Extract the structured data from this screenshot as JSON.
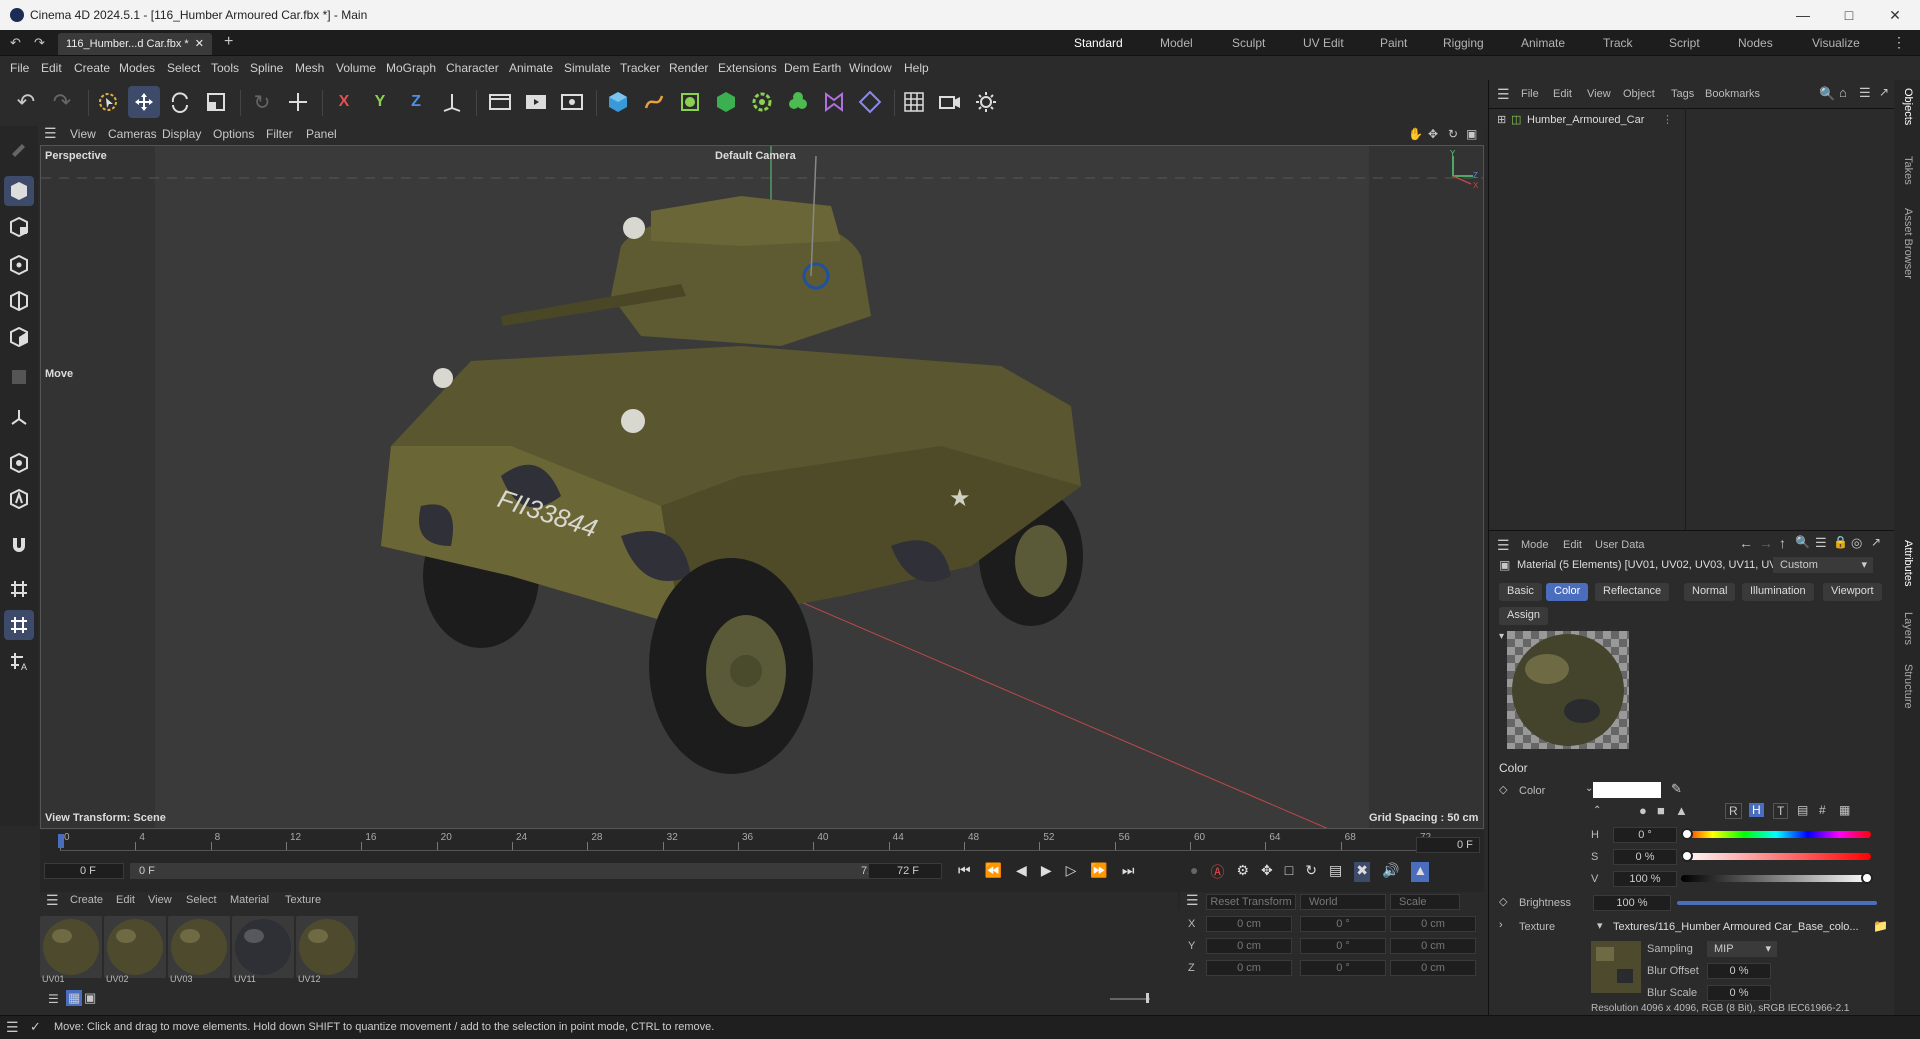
{
  "window": {
    "title": "Cinema 4D 2024.5.1 - [116_Humber Armoured Car.fbx *] - Main"
  },
  "doc_tab": {
    "label": "116_Humber...d Car.fbx *"
  },
  "layouts": [
    "Standard",
    "Model",
    "Sculpt",
    "UV Edit",
    "Paint",
    "Rigging",
    "Animate",
    "Track",
    "Script",
    "Nodes",
    "Visualize"
  ],
  "menu": [
    "File",
    "Edit",
    "Create",
    "Modes",
    "Select",
    "Tools",
    "Spline",
    "Mesh",
    "Volume",
    "MoGraph",
    "Character",
    "Animate",
    "Simulate",
    "Tracker",
    "Render",
    "Extensions",
    "Dem Earth",
    "Window",
    "Help"
  ],
  "axis_labels": {
    "x": "X",
    "y": "Y",
    "z": "Z"
  },
  "viewport_menu": [
    "View",
    "Cameras",
    "Display",
    "Options",
    "Filter",
    "Panel"
  ],
  "viewport": {
    "name": "Perspective",
    "camera": "Default Camera",
    "tool": "Move",
    "view_transform": "View Transform: Scene",
    "grid_spacing": "Grid Spacing : 50 cm",
    "plate": "FII33844"
  },
  "timeline": {
    "ticks": [
      "0",
      "4",
      "8",
      "12",
      "16",
      "20",
      "24",
      "28",
      "32",
      "36",
      "40",
      "44",
      "48",
      "52",
      "56",
      "60",
      "64",
      "68",
      "72"
    ],
    "current": "0 F",
    "start": "0 F",
    "range_start": "0 F",
    "range_end": "72 F",
    "end": "72 F"
  },
  "material_menu": [
    "Create",
    "Edit",
    "View",
    "Select",
    "Material",
    "Texture"
  ],
  "materials": [
    {
      "label": "UV01"
    },
    {
      "label": "UV02"
    },
    {
      "label": "UV03"
    },
    {
      "label": "UV11"
    },
    {
      "label": "UV12"
    }
  ],
  "coords": {
    "reset": "Reset Transform",
    "world": "World",
    "scale": "Scale",
    "rows": [
      {
        "axis": "X",
        "a": "0 cm",
        "b": "0 °",
        "c": "0 cm"
      },
      {
        "axis": "Y",
        "a": "0 cm",
        "b": "0 °",
        "c": "0 cm"
      },
      {
        "axis": "Z",
        "a": "0 cm",
        "b": "0 °",
        "c": "0 cm"
      }
    ]
  },
  "objects": {
    "menu": [
      "File",
      "Edit",
      "View",
      "Object",
      "Tags",
      "Bookmarks"
    ],
    "item": "Humber_Armoured_Car"
  },
  "attributes": {
    "menu": [
      "Mode",
      "Edit",
      "User Data"
    ],
    "header": "Material (5 Elements) [UV01, UV02, UV03, UV11, UV...",
    "custom": "Custom",
    "tabs": [
      "Basic",
      "Color",
      "Reflectance",
      "Normal",
      "Illumination",
      "Viewport"
    ],
    "assign": "Assign",
    "section": "Color",
    "color_label": "Color",
    "mode_buttons": [
      "R",
      "H",
      "T"
    ],
    "h_label": "H",
    "h": "0 °",
    "s_label": "S",
    "s": "0 %",
    "v_label": "V",
    "v": "100 %",
    "brightness_label": "Brightness",
    "brightness": "100 %",
    "texture_label": "Texture",
    "texture": "Textures/116_Humber Armoured Car_Base_colo...",
    "sampling_label": "Sampling",
    "sampling": "MIP",
    "blur_offset_label": "Blur Offset",
    "blur_offset": "0 %",
    "blur_scale_label": "Blur Scale",
    "blur_scale": "0 %",
    "resolution": "Resolution 4096 x 4096, RGB (8 Bit), sRGB IEC61966-2.1"
  },
  "side_tabs": [
    "Objects",
    "Takes",
    "Asset Browser",
    "Attributes",
    "Layers",
    "Structure"
  ],
  "status": "Move: Click and drag to move elements. Hold down SHIFT to quantize movement / add to the selection in point mode, CTRL to remove.",
  "colors": {
    "accent": "#4b6dbd",
    "vehicle": "#5a5630"
  }
}
